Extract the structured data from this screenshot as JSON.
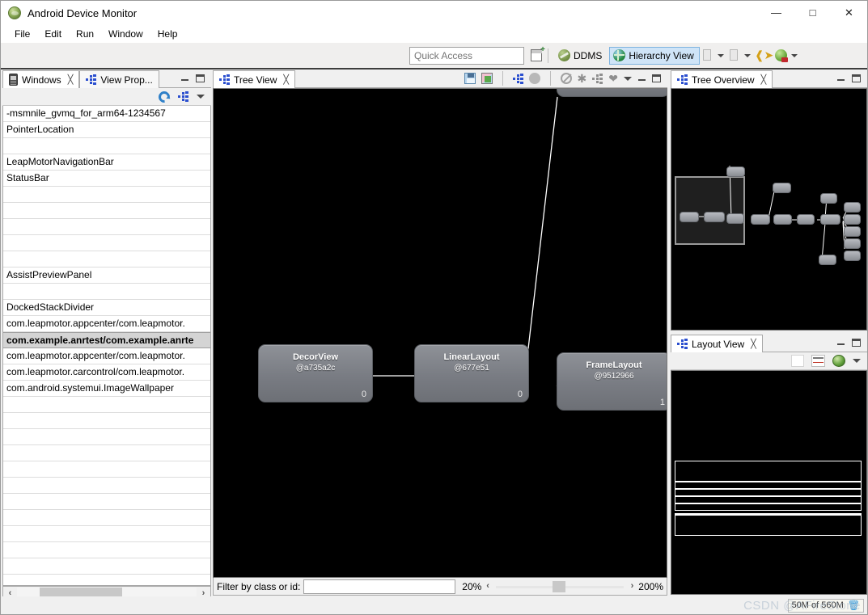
{
  "window": {
    "title": "Android Device Monitor",
    "icon": "android-monitor-icon",
    "minimize": "—",
    "maximize": "□",
    "close": "✕"
  },
  "menubar": {
    "items": [
      "File",
      "Edit",
      "Run",
      "Window",
      "Help"
    ]
  },
  "toolbar": {
    "quick_access_placeholder": "Quick Access",
    "new_window_icon": "new-window-icon",
    "perspectives": [
      {
        "label": "DDMS",
        "icon": "ddms-icon",
        "active": false
      },
      {
        "label": "Hierarchy View",
        "icon": "hierarchy-view-icon",
        "active": true
      }
    ],
    "extra_icons": [
      "open-perspective-icon",
      "restore-perspective-icon",
      "back-icon",
      "run-icon"
    ],
    "accent_active": "#cfe4f7"
  },
  "left_panel": {
    "tabs": [
      {
        "label": "Windows",
        "icon": "device-icon",
        "active": true,
        "closable": true
      },
      {
        "label": "View Prop...",
        "icon": "tree-icon",
        "active": false,
        "closable": false
      }
    ],
    "toolbar_icons": [
      "refresh-icon",
      "tree-icon",
      "view-menu-icon"
    ],
    "rows": [
      {
        "text": "-msmnile_gvmq_for_arm64-1234567",
        "selected": false
      },
      {
        "text": "PointerLocation",
        "selected": false
      },
      {
        "text": "",
        "selected": false
      },
      {
        "text": "LeapMotorNavigationBar",
        "selected": false
      },
      {
        "text": "StatusBar",
        "selected": false
      },
      {
        "text": "",
        "selected": false
      },
      {
        "text": "",
        "selected": false
      },
      {
        "text": "",
        "selected": false
      },
      {
        "text": "",
        "selected": false
      },
      {
        "text": "",
        "selected": false
      },
      {
        "text": "AssistPreviewPanel",
        "selected": false
      },
      {
        "text": "",
        "selected": false
      },
      {
        "text": "DockedStackDivider",
        "selected": false
      },
      {
        "text": "com.leapmotor.appcenter/com.leapmotor.",
        "selected": false
      },
      {
        "text": "com.example.anrtest/com.example.anrte",
        "selected": true
      },
      {
        "text": "com.leapmotor.appcenter/com.leapmotor.",
        "selected": false
      },
      {
        "text": "com.leapmotor.carcontrol/com.leapmotor.",
        "selected": false
      },
      {
        "text": "com.android.systemui.ImageWallpaper",
        "selected": false
      },
      {
        "text": "",
        "selected": false
      },
      {
        "text": "",
        "selected": false
      },
      {
        "text": "",
        "selected": false
      },
      {
        "text": "",
        "selected": false
      },
      {
        "text": "",
        "selected": false
      },
      {
        "text": "",
        "selected": false
      },
      {
        "text": "",
        "selected": false
      },
      {
        "text": "",
        "selected": false
      },
      {
        "text": "",
        "selected": false
      },
      {
        "text": "",
        "selected": false
      },
      {
        "text": "",
        "selected": false
      },
      {
        "text": "",
        "selected": false
      }
    ],
    "scroll_left_arrow": "‹",
    "scroll_right_arrow": "›"
  },
  "tree_view": {
    "tab": {
      "label": "Tree View",
      "icon": "tree-icon",
      "closable": true
    },
    "toolbar_icons": [
      "save-as-png-icon",
      "capture-layers-icon",
      "display-tree-icon",
      "profile-icon",
      "invalidate-icon",
      "request-layout-icon",
      "dump-hierarchy-icon",
      "pixel-perfect-icon"
    ],
    "nodes": [
      {
        "name": "DecorView",
        "id": "@a735a2c",
        "count": "0"
      },
      {
        "name": "LinearLayout",
        "id": "@677e51",
        "count": "0"
      },
      {
        "name": "FrameLayout",
        "id": "@9512966",
        "count": "1"
      }
    ],
    "filter_label": "Filter by class or id:",
    "filter_value": "",
    "zoom_min": "20%",
    "zoom_max": "200%",
    "zoom_left_arrow": "‹",
    "zoom_right_arrow": "›"
  },
  "tree_overview": {
    "tab": {
      "label": "Tree Overview",
      "icon": "tree-icon",
      "closable": true
    }
  },
  "layout_view": {
    "tab": {
      "label": "Layout View",
      "icon": "tree-icon",
      "closable": true
    },
    "toolbar_icons": [
      "show-extras-icon",
      "load-overlay-icon",
      "render-icon",
      "view-menu-icon"
    ]
  },
  "statusbar": {
    "memory": "50M of 560M",
    "trash_icon": "trash-icon",
    "watermark": "CSDN @AFireStone"
  }
}
